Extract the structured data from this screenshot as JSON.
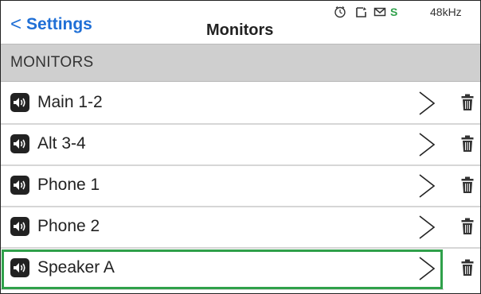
{
  "header": {
    "back_label": "Settings",
    "title": "Monitors",
    "status_icons": [
      "clock-icon",
      "document-icon",
      "mail-icon"
    ],
    "sync_label": "S",
    "sample_rate": "48kHz"
  },
  "section": {
    "label": "MONITORS"
  },
  "monitors": [
    {
      "label": "Main 1-2",
      "selected": false
    },
    {
      "label": "Alt 3-4",
      "selected": false
    },
    {
      "label": "Phone 1",
      "selected": false
    },
    {
      "label": "Phone 2",
      "selected": false
    },
    {
      "label": "Speaker A",
      "selected": true
    }
  ],
  "colors": {
    "accent": "#1f6fd6",
    "selection": "#2fa04a",
    "section_bg": "#cfcfcf"
  }
}
